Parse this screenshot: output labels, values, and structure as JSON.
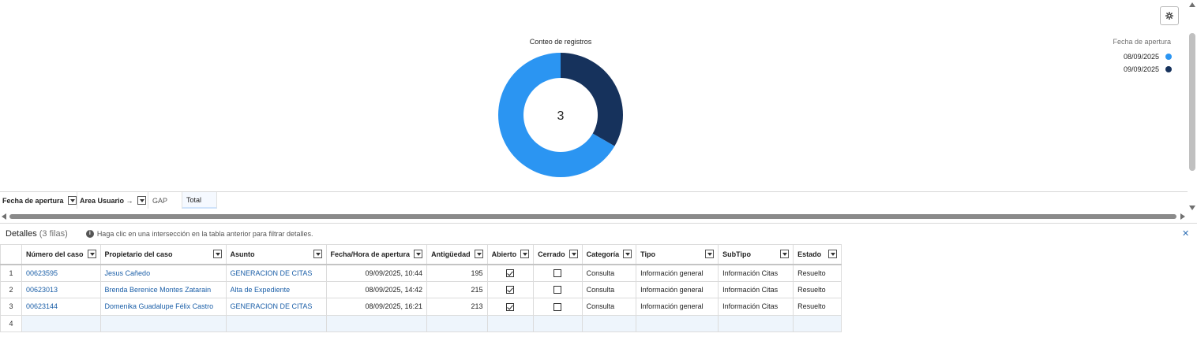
{
  "chart": {
    "title": "Conteo de registros",
    "center_total": "3",
    "legend_title": "Fecha de apertura",
    "legend": [
      {
        "label": "08/09/2025",
        "color": "#2b95f2"
      },
      {
        "label": "09/09/2025",
        "color": "#16325c"
      }
    ]
  },
  "chart_data": {
    "type": "pie",
    "title": "Conteo de registros",
    "categories": [
      "08/09/2025",
      "09/09/2025"
    ],
    "values": [
      2,
      1
    ],
    "colors": [
      "#2b95f2",
      "#16325c"
    ],
    "donut": true,
    "center_label": "3",
    "legend_title": "Fecha de apertura",
    "legend_position": "top-right"
  },
  "pivot": {
    "columns": [
      {
        "label": "Fecha de apertura",
        "filter": true
      },
      {
        "label": "Area Usuario →",
        "filter": true
      },
      {
        "label": "GAP",
        "filter": false
      },
      {
        "label": "Total",
        "filter": false
      }
    ]
  },
  "details": {
    "title": "Detalles",
    "count": "(3 filas)",
    "hint": "Haga clic en una intersección en la tabla anterior para filtrar detalles.",
    "close_symbol": "✕",
    "columns": [
      "Número del caso",
      "Propietario del caso",
      "Asunto",
      "Fecha/Hora de apertura",
      "Antigüedad",
      "Abierto",
      "Cerrado",
      "Categoría",
      "Tipo",
      "SubTipo",
      "Estado"
    ],
    "rows": [
      {
        "n": "1",
        "case": "00623595",
        "owner": "Jesus Cañedo",
        "subject": "GENERACION DE CITAS",
        "opened": "09/09/2025, 10:44",
        "age": "195",
        "open": true,
        "closed": false,
        "category": "Consulta",
        "type": "Información general",
        "subtype": "Información Citas",
        "status": "Resuelto"
      },
      {
        "n": "2",
        "case": "00623013",
        "owner": "Brenda Berenice Montes Zatarain",
        "subject": "Alta de Expediente",
        "opened": "08/09/2025, 14:42",
        "age": "215",
        "open": true,
        "closed": false,
        "category": "Consulta",
        "type": "Información general",
        "subtype": "Información Citas",
        "status": "Resuelto"
      },
      {
        "n": "3",
        "case": "00623144",
        "owner": "Domenika Guadalupe Félix Castro",
        "subject": "GENERACION DE CITAS",
        "opened": "08/09/2025, 16:21",
        "age": "213",
        "open": true,
        "closed": false,
        "category": "Consulta",
        "type": "Información general",
        "subtype": "Información Citas",
        "status": "Resuelto"
      }
    ],
    "empty_row_num": "4"
  },
  "colors": {
    "link": "#1b5fa8",
    "accent_light": "#2b95f2",
    "accent_dark": "#16325c"
  }
}
